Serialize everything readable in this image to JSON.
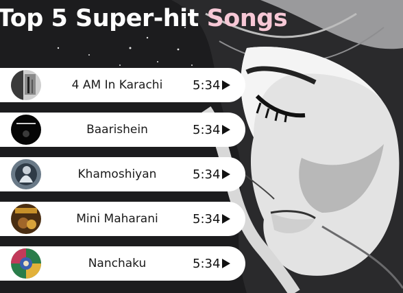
{
  "title": {
    "part1": "Top 5 Super-hit",
    "part2": "Songs"
  },
  "colors": {
    "title_white": "#ffffff",
    "title_pink": "#f7c8d6",
    "row_bg": "#ffffff"
  },
  "songs": [
    {
      "name": "4 AM In Karachi",
      "duration": "5:34",
      "thumb_icon": "album-cover-icon"
    },
    {
      "name": "Baarishein",
      "duration": "5:34",
      "thumb_icon": "album-cover-icon"
    },
    {
      "name": "Khamoshiyan",
      "duration": "5:34",
      "thumb_icon": "album-cover-icon"
    },
    {
      "name": "Mini Maharani",
      "duration": "5:34",
      "thumb_icon": "album-cover-icon"
    },
    {
      "name": "Nanchaku",
      "duration": "5:34",
      "thumb_icon": "album-cover-icon"
    }
  ],
  "play_icon": "play-icon"
}
